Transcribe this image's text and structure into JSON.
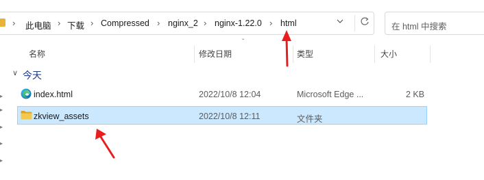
{
  "address": {
    "crumbs": [
      "此电脑",
      "下载",
      "Compressed",
      "nginx_2",
      "nginx-1.22.0",
      "html"
    ],
    "separator": "›",
    "dropdown_icon": "chevron-down-icon"
  },
  "search": {
    "placeholder": "在 html 中搜索"
  },
  "columns": {
    "name": "名称",
    "modified": "修改日期",
    "type": "类型",
    "size": "大小",
    "sort_indicator": "ˇ"
  },
  "group": {
    "label": "今天",
    "chevron": "∨"
  },
  "files": [
    {
      "name": "index.html",
      "modified": "2022/10/8 12:04",
      "type": "Microsoft Edge ...",
      "size": "2 KB",
      "icon": "edge-icon"
    },
    {
      "name": "zkview_assets",
      "modified": "2022/10/8 12:11",
      "type": "文件夹",
      "size": "",
      "icon": "folder-icon",
      "selected": true
    }
  ],
  "colors": {
    "selection_bg": "#cce8ff",
    "selection_border": "#99d1ff",
    "folder": "#e8b437",
    "annotation": "#e81e1e",
    "group_label": "#1e3a8a"
  }
}
